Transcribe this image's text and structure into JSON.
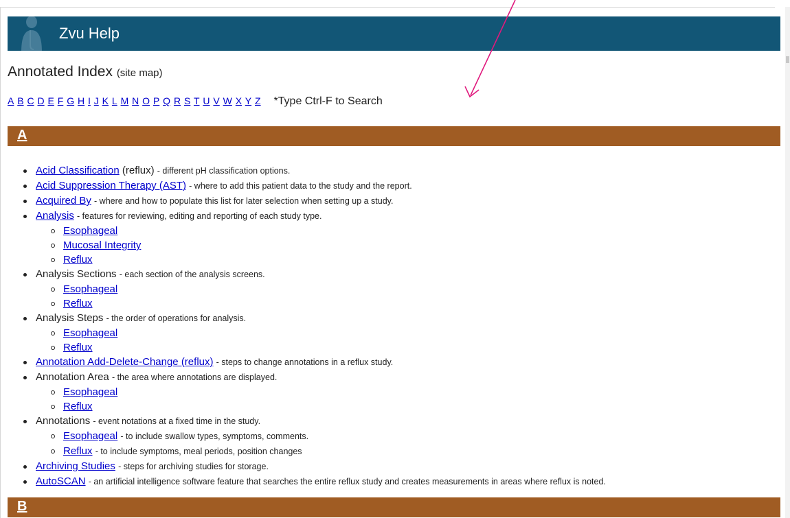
{
  "header": {
    "title": "Zvu Help"
  },
  "page": {
    "title": "Annotated Index",
    "subtitle": "(site map)"
  },
  "alphabet": [
    "A",
    "B",
    "C",
    "D",
    "E",
    "F",
    "G",
    "H",
    "I",
    "J",
    "K",
    "L",
    "M",
    "N",
    "O",
    "P",
    "Q",
    "R",
    "S",
    "T",
    "U",
    "V",
    "W",
    "X",
    "Y",
    "Z"
  ],
  "search_hint": "*Type Ctrl-F to Search",
  "colors": {
    "header_bg": "#125676",
    "section_bg": "#a05c23",
    "link": "#0000cc",
    "arrow": "#e0197d"
  },
  "sections": [
    {
      "letter": "A",
      "items": [
        {
          "label": "Acid Classification",
          "link": true,
          "qualifier": "(reflux)",
          "desc": "- different pH classification options."
        },
        {
          "label": "Acid Suppression Therapy (AST)",
          "link": true,
          "desc": "- where to add this patient data to the study and the report."
        },
        {
          "label": "Acquired By",
          "link": true,
          "desc": "- where and how to populate this list for later selection when setting up a study."
        },
        {
          "label": "Analysis",
          "link": true,
          "desc": "- features for reviewing, editing and reporting of each study type.",
          "children": [
            {
              "label": "Esophageal"
            },
            {
              "label": "Mucosal Integrity"
            },
            {
              "label": "Reflux"
            }
          ]
        },
        {
          "label": "Analysis Sections",
          "link": false,
          "desc": "- each section of the analysis screens.",
          "children": [
            {
              "label": "Esophageal"
            },
            {
              "label": "Reflux"
            }
          ]
        },
        {
          "label": "Analysis Steps",
          "link": false,
          "desc": "- the order of operations for analysis.",
          "children": [
            {
              "label": "Esophageal"
            },
            {
              "label": "Reflux"
            }
          ]
        },
        {
          "label": "Annotation Add-Delete-Change (reflux)",
          "link": true,
          "desc": "- steps to change annotations in a reflux study."
        },
        {
          "label": "Annotation Area",
          "link": false,
          "desc": "- the area where annotations are displayed.",
          "children": [
            {
              "label": "Esophageal"
            },
            {
              "label": "Reflux"
            }
          ]
        },
        {
          "label": "Annotations",
          "link": false,
          "desc": "- event notations at a fixed time in the study.",
          "children": [
            {
              "label": "Esophageal",
              "desc": "- to include swallow types, symptoms, comments."
            },
            {
              "label": "Reflux",
              "desc": "- to include symptoms, meal periods, position changes"
            }
          ]
        },
        {
          "label": "Archiving Studies",
          "link": true,
          "desc": "- steps for archiving studies for storage."
        },
        {
          "label": "AutoSCAN",
          "link": true,
          "desc": "- an artificial intelligence software feature that searches the entire reflux study and creates measurements in areas where reflux is noted."
        }
      ]
    },
    {
      "letter": "B",
      "items": []
    }
  ]
}
